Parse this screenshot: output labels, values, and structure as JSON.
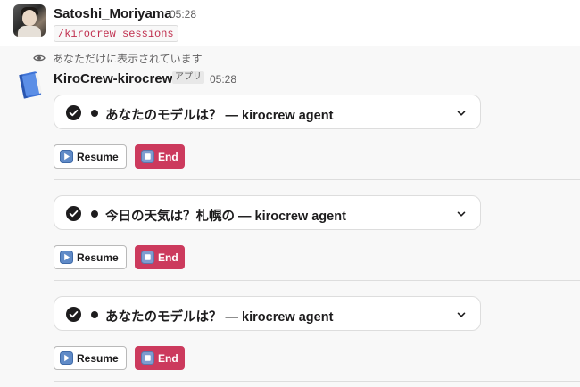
{
  "user_message": {
    "name": "Satoshi_Moriyama",
    "time": "05:28",
    "command": "/kirocrew sessions"
  },
  "bot_message": {
    "visibility_note": "あなただけに表示されています",
    "name": "KiroCrew-kirocrew",
    "app_badge": "アプリ",
    "time": "05:28"
  },
  "sessions": [
    {
      "title": "あなたのモデルは？ — kirocrew agent",
      "resume_label": "Resume",
      "end_label": "End"
    },
    {
      "title": "今日の天気は？札幌の — kirocrew agent",
      "resume_label": "Resume",
      "end_label": "End"
    },
    {
      "title": "あなたのモデルは？ — kirocrew agent",
      "resume_label": "Resume",
      "end_label": "End"
    }
  ],
  "colors": {
    "end_button": "#cc3a5d",
    "code_text": "#c0304f",
    "resume_icon": "#5f8ac7"
  },
  "icons": {
    "visibility": "eye-icon",
    "status": "check-circle-icon",
    "expand": "chevron-down-icon",
    "resume": "play-icon",
    "end": "stop-icon"
  }
}
